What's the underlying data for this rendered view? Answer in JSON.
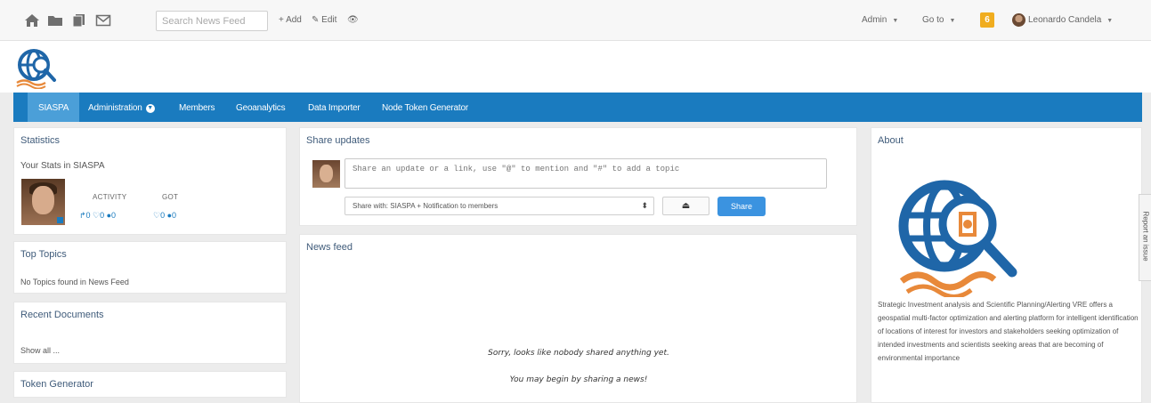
{
  "topbar": {
    "search_placeholder": "Search News Feed",
    "add_label": "+ Add",
    "edit_label": "Edit",
    "admin_label": "Admin",
    "goto_label": "Go to",
    "notification_count": "6",
    "user_name": "Leonardo Candela",
    "icons": [
      "home-icon",
      "folder-icon",
      "documents-icon",
      "mail-icon",
      "eye-icon"
    ]
  },
  "nav": {
    "items": [
      {
        "label": "SIASPA"
      },
      {
        "label": "Administration"
      },
      {
        "label": "Members"
      },
      {
        "label": "Geoanalytics"
      },
      {
        "label": "Data Importer"
      },
      {
        "label": "Node Token Generator"
      }
    ],
    "active": "SIASPA",
    "color": "#1a7bbf"
  },
  "statistics": {
    "title": "Statistics",
    "subtitle": "Your Stats in SIASPA",
    "activity_label": "ACTIVITY",
    "got_label": "GOT",
    "activity_row": "↱0 ♡0 ●0",
    "got_row": "♡0 ●0"
  },
  "top_topics": {
    "title": "Top Topics",
    "text": "No Topics found in News Feed"
  },
  "recent_documents": {
    "title": "Recent Documents",
    "show_all": "Show all ..."
  },
  "token_generator": {
    "title": "Token Generator"
  },
  "share": {
    "title": "Share updates",
    "placeholder": "Share an update or a link, use \"@\" to mention and \"#\" to add a topic",
    "share_with": "Share with: SIASPA + Notification to members",
    "button_label": "Share"
  },
  "news_feed": {
    "title": "News feed",
    "empty_line1": "Sorry, looks like nobody shared anything yet.",
    "empty_line2": "You may begin by sharing a news!"
  },
  "about": {
    "title": "About",
    "text": "Strategic Investment analysis and Scientific Planning/Alerting VRE offers a geospatial multi-factor optimization and alerting platform for intelligent identification of locations of interest for investors and stakeholders seeking optimization of intended investments and scientists seeking areas that are becoming of environmental importance"
  },
  "report_issue": "Report an issue"
}
